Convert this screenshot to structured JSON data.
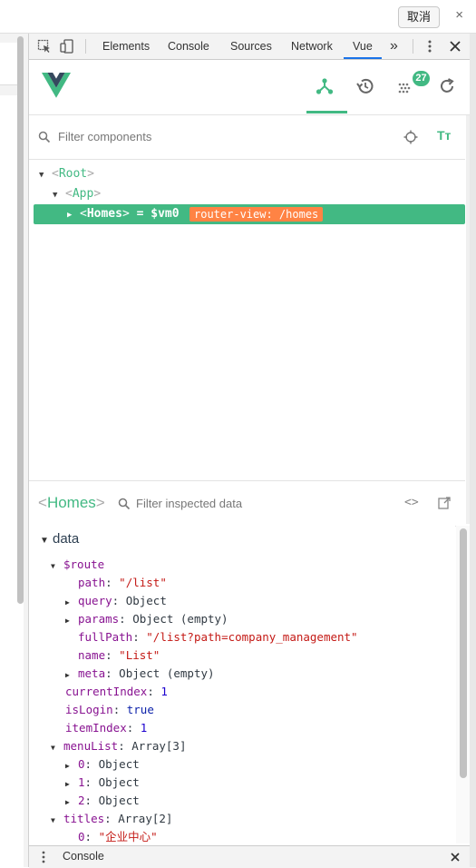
{
  "top": {
    "cancel_label": "取消",
    "close_glyph": "×"
  },
  "devtools_tabs": [
    {
      "label": "Elements"
    },
    {
      "label": "Console"
    },
    {
      "label": "Sources"
    },
    {
      "label": "Network"
    },
    {
      "label": "Vue",
      "active": true
    }
  ],
  "overflow_glyph": "»",
  "vue": {
    "badge_count": "27",
    "accent_color": "#42b983",
    "filter_components_placeholder": "Filter components",
    "tt_label": "Tт"
  },
  "tree": {
    "root": "Root",
    "app": "App",
    "selected": {
      "name": "Homes",
      "eq": "= $vm0",
      "route_badge": "router-view: /homes"
    }
  },
  "inspector": {
    "component_name": "Homes",
    "filter_placeholder": "Filter inspected data",
    "code_glyph": "<>",
    "section_label": "data"
  },
  "data": {
    "route_key": "$route",
    "path": {
      "key": "path",
      "value": "\"/list\""
    },
    "query": {
      "key": "query",
      "value": "Object"
    },
    "params": {
      "key": "params",
      "value": "Object (empty)"
    },
    "fullPath": {
      "key": "fullPath",
      "value": "\"/list?path=company_management\""
    },
    "name": {
      "key": "name",
      "value": "\"List\""
    },
    "meta": {
      "key": "meta",
      "value": "Object (empty)"
    },
    "currentIndex": {
      "key": "currentIndex",
      "value": "1"
    },
    "isLogin": {
      "key": "isLogin",
      "value": "true"
    },
    "itemIndex": {
      "key": "itemIndex",
      "value": "1"
    },
    "menuList": {
      "key": "menuList",
      "value": "Array[3]"
    },
    "menu0": {
      "key": "0",
      "value": "Object"
    },
    "menu1": {
      "key": "1",
      "value": "Object"
    },
    "menu2": {
      "key": "2",
      "value": "Object"
    },
    "titles": {
      "key": "titles",
      "value": "Array[2]"
    },
    "title0": {
      "key": "0",
      "value": "\"企业中心\""
    }
  },
  "console_drawer": {
    "label": "Console"
  },
  "colon": ": "
}
